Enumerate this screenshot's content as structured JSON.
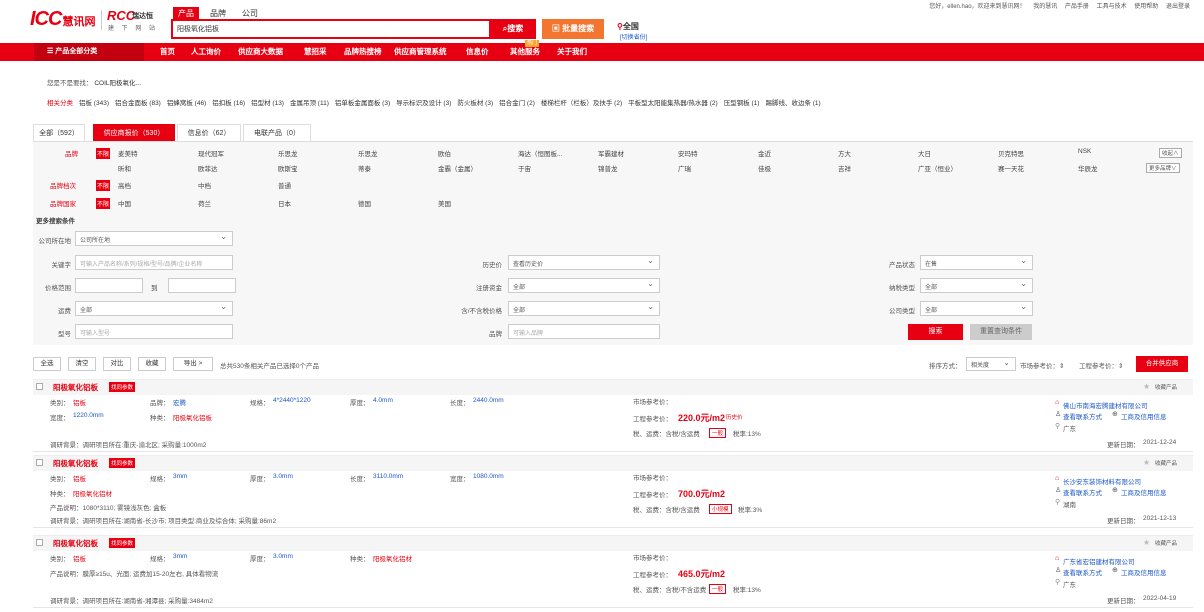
{
  "header": {
    "logo_main": "ICC",
    "logo_main_sub": "慧讯网",
    "logo_second": "RCC",
    "logo_second_sub": "瑞达恒",
    "logo_second_tag": "建 下 网 站",
    "search_tabs": [
      "产品",
      "品牌",
      "公司"
    ],
    "search_value": "阳极氧化铝板",
    "search_label": "搜索",
    "bulk_label": "批量搜索",
    "location": "全国",
    "location_sub": "[切换省份]",
    "top_links": [
      "您好，ellen.hao，欢迎来到慧讯网！",
      "我的慧讯",
      "产品手册",
      "工具与技术",
      "使用帮助",
      "退出登录"
    ]
  },
  "nav": {
    "category_label": "产品全部分类",
    "items": [
      "首页",
      "人工询价",
      "供应商大数据",
      "慧招采",
      "品牌热搜榜",
      "供应商管理系统",
      "信息价",
      "其他服务",
      "关于我们"
    ],
    "hot_badge": "热门"
  },
  "suggest": {
    "label": "您是不是要找：",
    "value": "COIL阳极氧化..."
  },
  "related": {
    "label": "相关分类",
    "items": [
      "铝板 (343)",
      "铝合金面板 (83)",
      "铝蜂窝板 (46)",
      "铝扣板 (16)",
      "铝型材 (13)",
      "金属吊顶 (11)",
      "铝单板金属面板 (3)",
      "导示标识及设计 (3)",
      "防火板材 (3)",
      "铝合金门 (2)",
      "楼梯栏杆（栏板）及扶手 (2)",
      "平板型太阳能集热器/热水器 (2)",
      "压型钢板 (1)",
      "踢脚线、收边条 (1)"
    ]
  },
  "tabs": [
    {
      "label": "全部（592）",
      "active": false
    },
    {
      "label": "供应商报价（530）",
      "active": true
    },
    {
      "label": "信息价（62）",
      "active": false
    },
    {
      "label": "电联产品（0）",
      "active": false
    }
  ],
  "filters": {
    "brand_label": "品牌",
    "unlimited": "不限",
    "brand_row1": [
      "麦美特",
      "现代冠军",
      "乐思龙",
      "乐思龙",
      "欧伯",
      "海达（恒图板...",
      "军霸建材",
      "安玛特",
      "金近",
      "方大",
      "大日",
      "贝克特思",
      "NSK"
    ],
    "brand_row2": [
      "昕和",
      "欧菲达",
      "欧斯宝",
      "蒂泰",
      "金霸（金属）",
      "于宙",
      "锦普龙",
      "广瑞",
      "佳极",
      "吉祥",
      "广亚（恒业）",
      "赛一天花",
      "华辰龙"
    ],
    "collapse_label": "收起∧",
    "more_brand_label": "更多品牌∨",
    "grade_label": "品牌档次",
    "grades": [
      "高档",
      "中档",
      "普通"
    ],
    "country_label": "品牌国家",
    "countries": [
      "中国",
      "荷兰",
      "日本",
      "德国",
      "美国"
    ],
    "more_label": "更多搜索条件"
  },
  "form": {
    "company_loc_label": "公司所在地",
    "company_loc_value": "公司所在地",
    "keyword_label": "关键字",
    "keyword_placeholder": "可输入产品名称/系列/规格/型号/品牌/企业名称",
    "history_label": "历史价",
    "history_value": "查看历史价",
    "status_label": "产品状态",
    "status_value": "在售",
    "price_label": "价格范围",
    "price_to": "到",
    "capital_label": "注册资金",
    "capital_value": "全部",
    "tax_label": "纳税类型",
    "tax_value": "全部",
    "freight_label": "运费",
    "freight_value": "全部",
    "taxinc_label": "含/不含税价格",
    "taxinc_value": "全部",
    "comptype_label": "公司类型",
    "comptype_value": "全部",
    "model_label": "型号",
    "model_placeholder": "可输入型号",
    "brand_label": "品牌",
    "brand_placeholder": "可输入品牌",
    "search_btn": "搜索",
    "reset_btn": "重置查询条件"
  },
  "toolbar": {
    "buttons": [
      "全选",
      "清空",
      "对比",
      "收藏",
      "导出 >"
    ],
    "summary": "总共530条相关产品已选择0个产品",
    "sort_label": "排序方式：",
    "sort_value": "相关度",
    "market_ref": "市场参考价：⇕",
    "eng_ref": "工程参考价：⇕",
    "partner_btn": "合并供应商"
  },
  "products": [
    {
      "name": "阳极氧化铝板",
      "badge": "找同参数",
      "fields_row1": [
        [
          "类别：",
          "铝板"
        ],
        [
          "品牌：",
          "宏腾"
        ],
        [
          "规格：",
          "4*2440*1220"
        ],
        [
          "厚度：",
          "4.0mm"
        ],
        [
          "长度：",
          "2440.0mm"
        ]
      ],
      "fields_row2": [
        [
          "宽度：",
          "1220.0mm"
        ],
        [
          "种类：",
          "阳极氧化铝板"
        ]
      ],
      "market_label": "市场参考价：",
      "eng_label": "工程参考价：",
      "eng_price": "220.0元/m2",
      "history_tag": "历史价",
      "tax_text": "税、运费：含税/含运费",
      "tax_tag": "一般",
      "rate": "税率:13%",
      "research": "调研背景：调研项目所在:重庆-渝北区;  采购量:1000m2",
      "company": "佛山市南海宏腾建材有限公司",
      "contact": "查看联系方式",
      "credit": "工商及信用信息",
      "region": "广东",
      "fav": "收藏产品",
      "date_label": "更新日期：",
      "date": "2021-12-24"
    },
    {
      "name": "阳极氧化铝板",
      "badge": "找同参数",
      "fields_row1": [
        [
          "类别：",
          "铝板"
        ],
        [
          "规格：",
          "3mm"
        ],
        [
          "厚度：",
          "3.0mm"
        ],
        [
          "长度：",
          "3110.0mm"
        ],
        [
          "宽度：",
          "1080.0mm"
        ]
      ],
      "fields_row2": [
        [
          "种类：",
          "阳极氧化铝材"
        ]
      ],
      "desc": "产品说明：1080*3110; 雾镜浅灰色; 盒板",
      "market_label": "市场参考价：",
      "eng_label": "工程参考价：",
      "eng_price": "700.0元/m2",
      "tax_text": "税、运费：含税/含运费",
      "tax_tag": "小规模",
      "rate": "税率:3%",
      "research": "调研背景：调研项目所在:湖南省-长沙市;  项目类型:商业及综合体;  采购量:86m2",
      "company": "长沙安东装饰材料有限公司",
      "contact": "查看联系方式",
      "credit": "工商及信用信息",
      "region": "湖南",
      "fav": "收藏产品",
      "date_label": "更新日期：",
      "date": "2021-12-13"
    },
    {
      "name": "阳极氧化铝板",
      "badge": "找同参数",
      "fields_row1": [
        [
          "类别：",
          "铝板"
        ],
        [
          "规格：",
          "3mm"
        ],
        [
          "厚度：",
          "3.0mm"
        ],
        [
          "种类：",
          "阳极氧化铝材"
        ]
      ],
      "desc": "产品说明：膜厚≥15u、光面; 运费加15-20左右, 具体看物流",
      "market_label": "市场参考价：",
      "eng_label": "工程参考价：",
      "eng_price": "465.0元/m2",
      "tax_text": "税、运费：含税/不含运费",
      "tax_tag": "一般",
      "rate": "税率:13%",
      "research": "调研背景：调研项目所在:湖南省-湘潭县;  采购量:3484m2",
      "company": "广东省宏铝建材有限公司",
      "contact": "查看联系方式",
      "credit": "工商及信用信息",
      "region": "广东",
      "fav": "收藏产品",
      "date_label": "更新日期：",
      "date": "2022-04-19"
    }
  ]
}
